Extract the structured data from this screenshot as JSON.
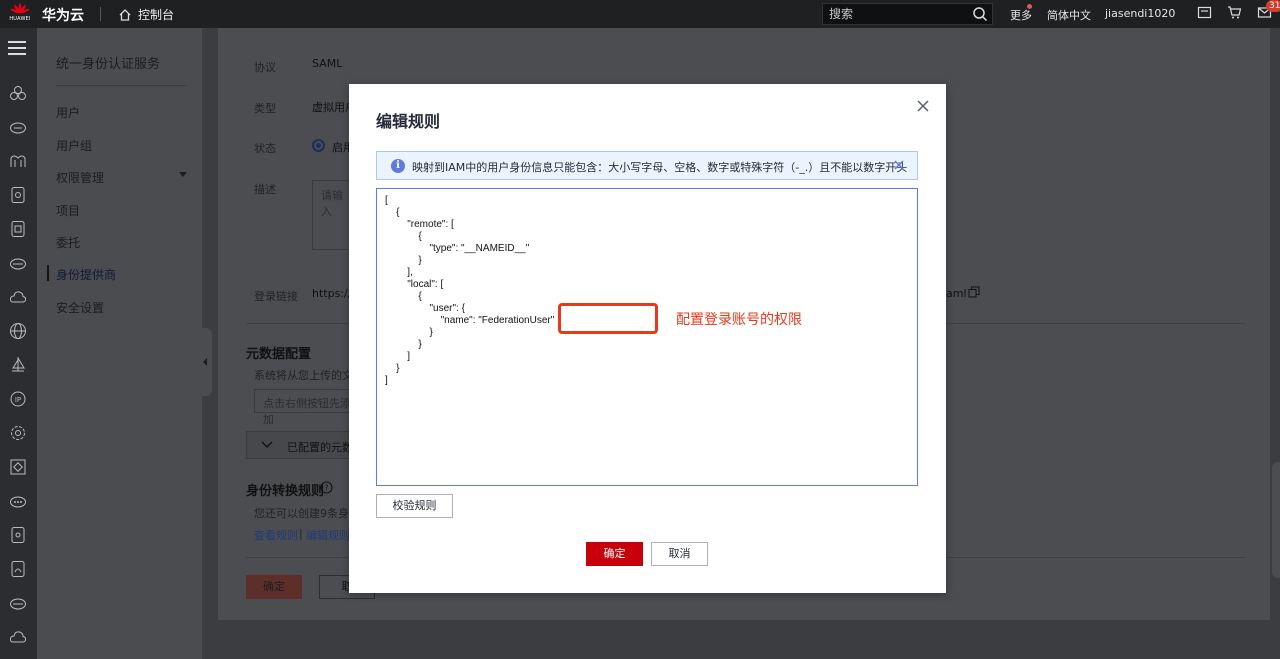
{
  "topbar": {
    "logo_text": "HUAWEI",
    "brand": "华为云",
    "console": "控制台",
    "search_placeholder": "搜索",
    "more": "更多",
    "language": "简体中文",
    "username": "jiasendi1020",
    "message_count": "31"
  },
  "sidebar": {
    "title": "统一身份认证服务",
    "items": [
      "用户",
      "用户组",
      "权限管理",
      "项目",
      "委托",
      "身份提供商",
      "安全设置"
    ],
    "active_index": 5
  },
  "main": {
    "protocol_label": "协议",
    "protocol_value": "SAML",
    "type_label": "类型",
    "type_value": "虚拟用户",
    "status_label": "状态",
    "status_value": "启用",
    "description_label": "描述",
    "description_placeholder": "请输入",
    "login_link_label": "登录链接",
    "login_link_start": "https://a",
    "login_link_end": "aml",
    "metadata_heading": "元数据配置",
    "metadata_text": "系统将从您上传的文",
    "metadata_input_placeholder": "点击右侧按钮先添加",
    "metadata_collapse": "已配置的元数",
    "rules_heading": "身份转换规则",
    "rules_text": "您还可以创建9条身份",
    "view_rules": "查看规则",
    "rules_sep": "|",
    "edit_rules": "编辑规则",
    "ok": "确定",
    "cancel": "取"
  },
  "modal": {
    "title": "编辑规则",
    "alert_text": "映射到IAM中的用户身份信息只能包含：大小写字母、空格、数字或特殊字符（-_.）且不能以数字开头",
    "code": "[\n\t{\n\t\t\"remote\": [\n\t\t\t{\n\t\t\t\t\"type\": \"__NAMEID__\"\n\t\t\t}\n\t\t],\n\t\t\"local\": [\n\t\t\t{\n\t\t\t\t\"user\": {\n\t\t\t\t\t\"name\": \"FederationUser\"\n\t\t\t\t}\n\t\t\t}\n\t\t]\n\t}\n]",
    "annotation": "配置登录账号的权限",
    "verify_button": "校验规则",
    "ok_button": "确定",
    "cancel_button": "取消"
  },
  "colors": {
    "primary_red": "#c7000b",
    "annotation_red": "#e8391d",
    "info_blue": "#5e7ce0"
  }
}
